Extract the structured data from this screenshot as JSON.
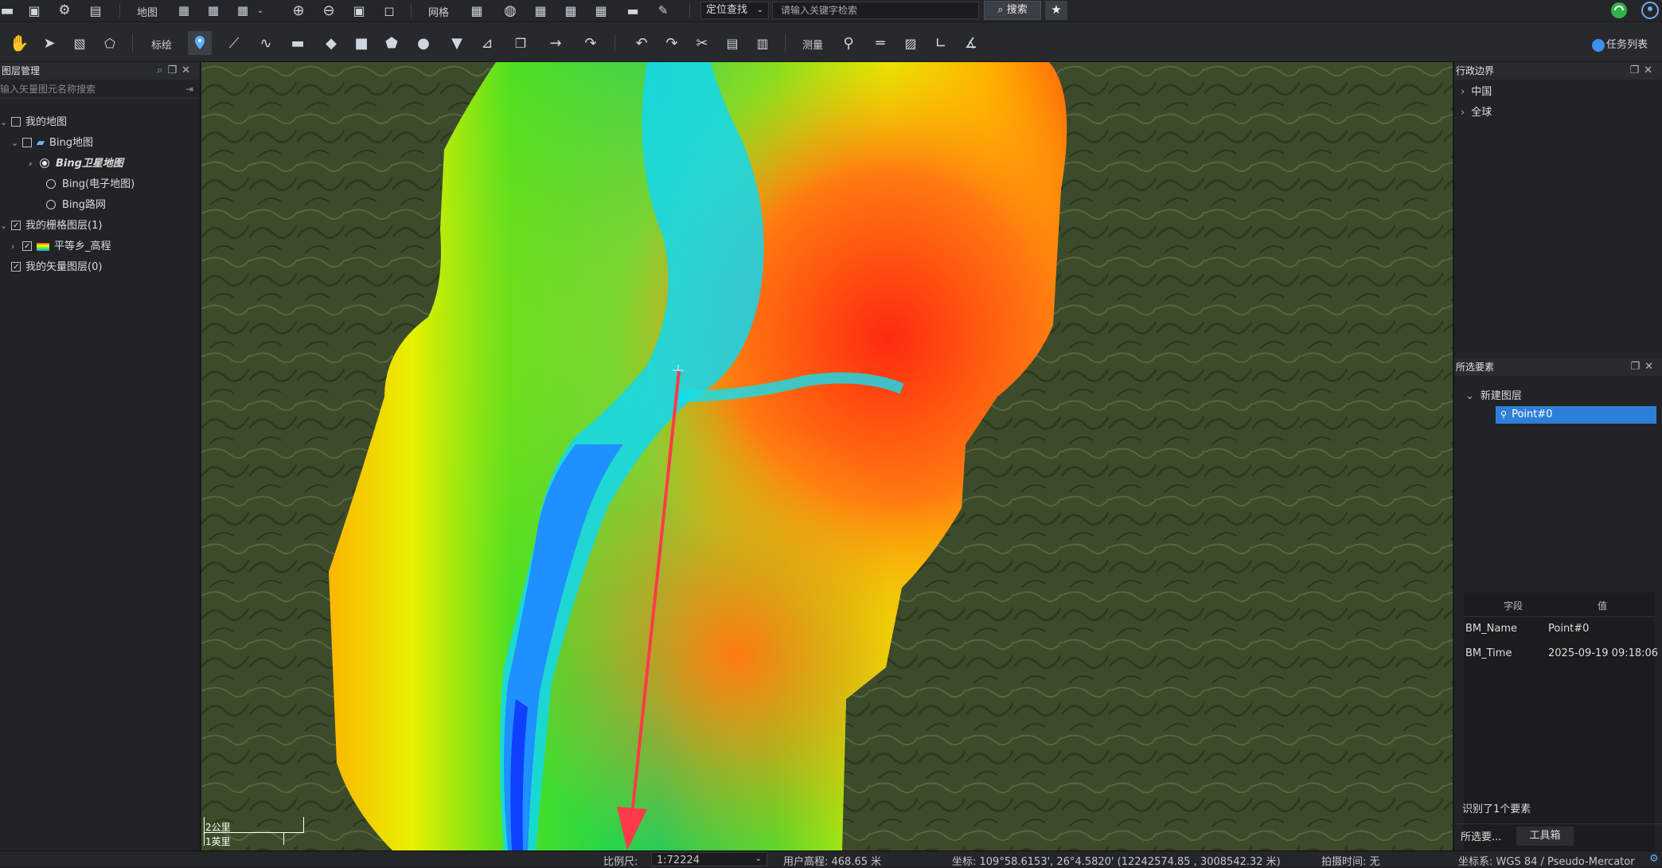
{
  "toolbar_top": {
    "map_label": "地图",
    "grid_label": "网格",
    "locate_select": "定位查找",
    "search_placeholder": "请输入关键字检索",
    "search_button": "搜索"
  },
  "toolbar_second": {
    "annotate_label": "标绘",
    "measure_label": "测量",
    "task_list": "任务列表"
  },
  "layer_panel": {
    "title": "图层管理",
    "search_placeholder": "输入矢量图元名称搜索",
    "tree": [
      {
        "label": "我的地图"
      },
      {
        "label": "Bing地图"
      },
      {
        "label": "Bing卫星地图"
      },
      {
        "label": "Bing(电子地图)"
      },
      {
        "label": "Bing路网"
      },
      {
        "label": "我的栅格图层(1)"
      },
      {
        "label": "平等乡_高程"
      },
      {
        "label": "我的矢量图层(0)"
      }
    ]
  },
  "map": {
    "scalebar_top": "2公里",
    "scalebar_bottom": "1英里"
  },
  "admin_panel": {
    "title": "行政边界",
    "items": [
      "中国",
      "全球"
    ]
  },
  "selected_panel": {
    "title": "所选要素",
    "layer": "新建图层",
    "feature": "Point#0",
    "table_headers": [
      "字段",
      "值"
    ],
    "rows": [
      {
        "field": "BM_Name",
        "value": "Point#0"
      },
      {
        "field": "BM_Time",
        "value": "2025-09-19 09:18:06"
      }
    ],
    "status": "识别了1个要素",
    "tabs": [
      "所选要...",
      "工具箱"
    ]
  },
  "status_bar": {
    "scale_label": "比例尺:",
    "scale_value": "1:72224",
    "elevation": "用户高程: 468.65 米",
    "coords": "坐标: 109°58.6153', 26°4.5820'  (12242574.85 , 3008542.32 米)",
    "capture_time": "拍摄时间: 无",
    "crs": "坐标系: WGS 84 / Pseudo-Mercator"
  }
}
